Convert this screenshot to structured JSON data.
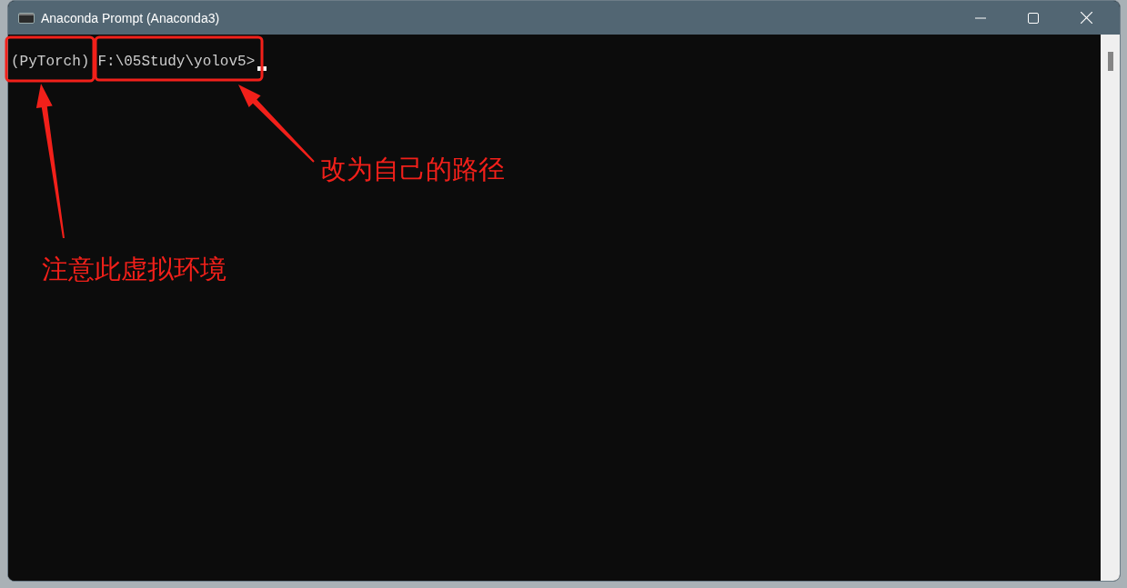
{
  "window": {
    "title": "Anaconda Prompt (Anaconda3)"
  },
  "prompt": {
    "environment": "(PyTorch)",
    "path": "F:\\05Study\\yolov5>"
  },
  "annotations": [
    {
      "label": "注意此虚拟环境"
    },
    {
      "label": "改为自己的路径"
    }
  ]
}
